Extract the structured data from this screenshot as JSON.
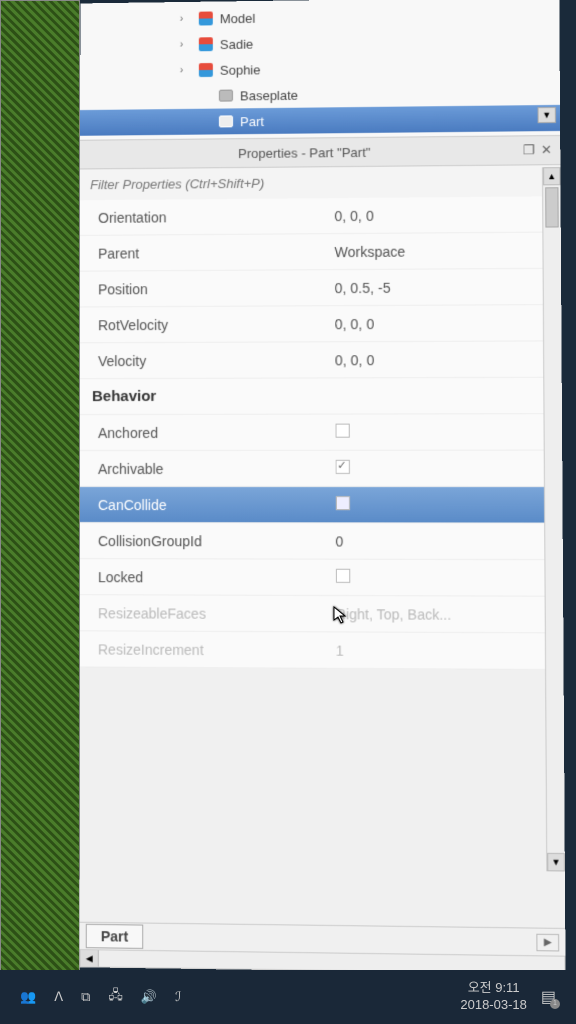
{
  "explorer": {
    "items": [
      {
        "label": "Model",
        "icon": "model",
        "expandable": true
      },
      {
        "label": "Sadie",
        "icon": "model",
        "expandable": true
      },
      {
        "label": "Sophie",
        "icon": "model",
        "expandable": true
      },
      {
        "label": "Baseplate",
        "icon": "part",
        "expandable": false
      },
      {
        "label": "Part",
        "icon": "part",
        "expandable": false,
        "selected": true
      }
    ]
  },
  "properties": {
    "title": "Properties - Part \"Part\"",
    "filter_placeholder": "Filter Properties (Ctrl+Shift+P)",
    "rows": [
      {
        "name": "Orientation",
        "value": "0, 0, 0",
        "type": "text"
      },
      {
        "name": "Parent",
        "value": "Workspace",
        "type": "text"
      },
      {
        "name": "Position",
        "value": "0, 0.5, -5",
        "type": "text"
      },
      {
        "name": "RotVelocity",
        "value": "0, 0, 0",
        "type": "text"
      },
      {
        "name": "Velocity",
        "value": "0, 0, 0",
        "type": "text"
      },
      {
        "name": "Behavior",
        "type": "category"
      },
      {
        "name": "Anchored",
        "type": "check",
        "checked": false
      },
      {
        "name": "Archivable",
        "type": "check",
        "checked": true
      },
      {
        "name": "CanCollide",
        "type": "check",
        "checked": false,
        "selected": true
      },
      {
        "name": "CollisionGroupId",
        "value": "0",
        "type": "text"
      },
      {
        "name": "Locked",
        "type": "check",
        "checked": false
      },
      {
        "name": "ResizeableFaces",
        "value": "Right, Top, Back...",
        "type": "text",
        "faded": true
      },
      {
        "name": "ResizeIncrement",
        "value": "1",
        "type": "text",
        "faded": true
      }
    ]
  },
  "tabs": {
    "active": "Part"
  },
  "taskbar": {
    "time": "오전 9:11",
    "date": "2018-03-18",
    "notif_count": "1"
  }
}
